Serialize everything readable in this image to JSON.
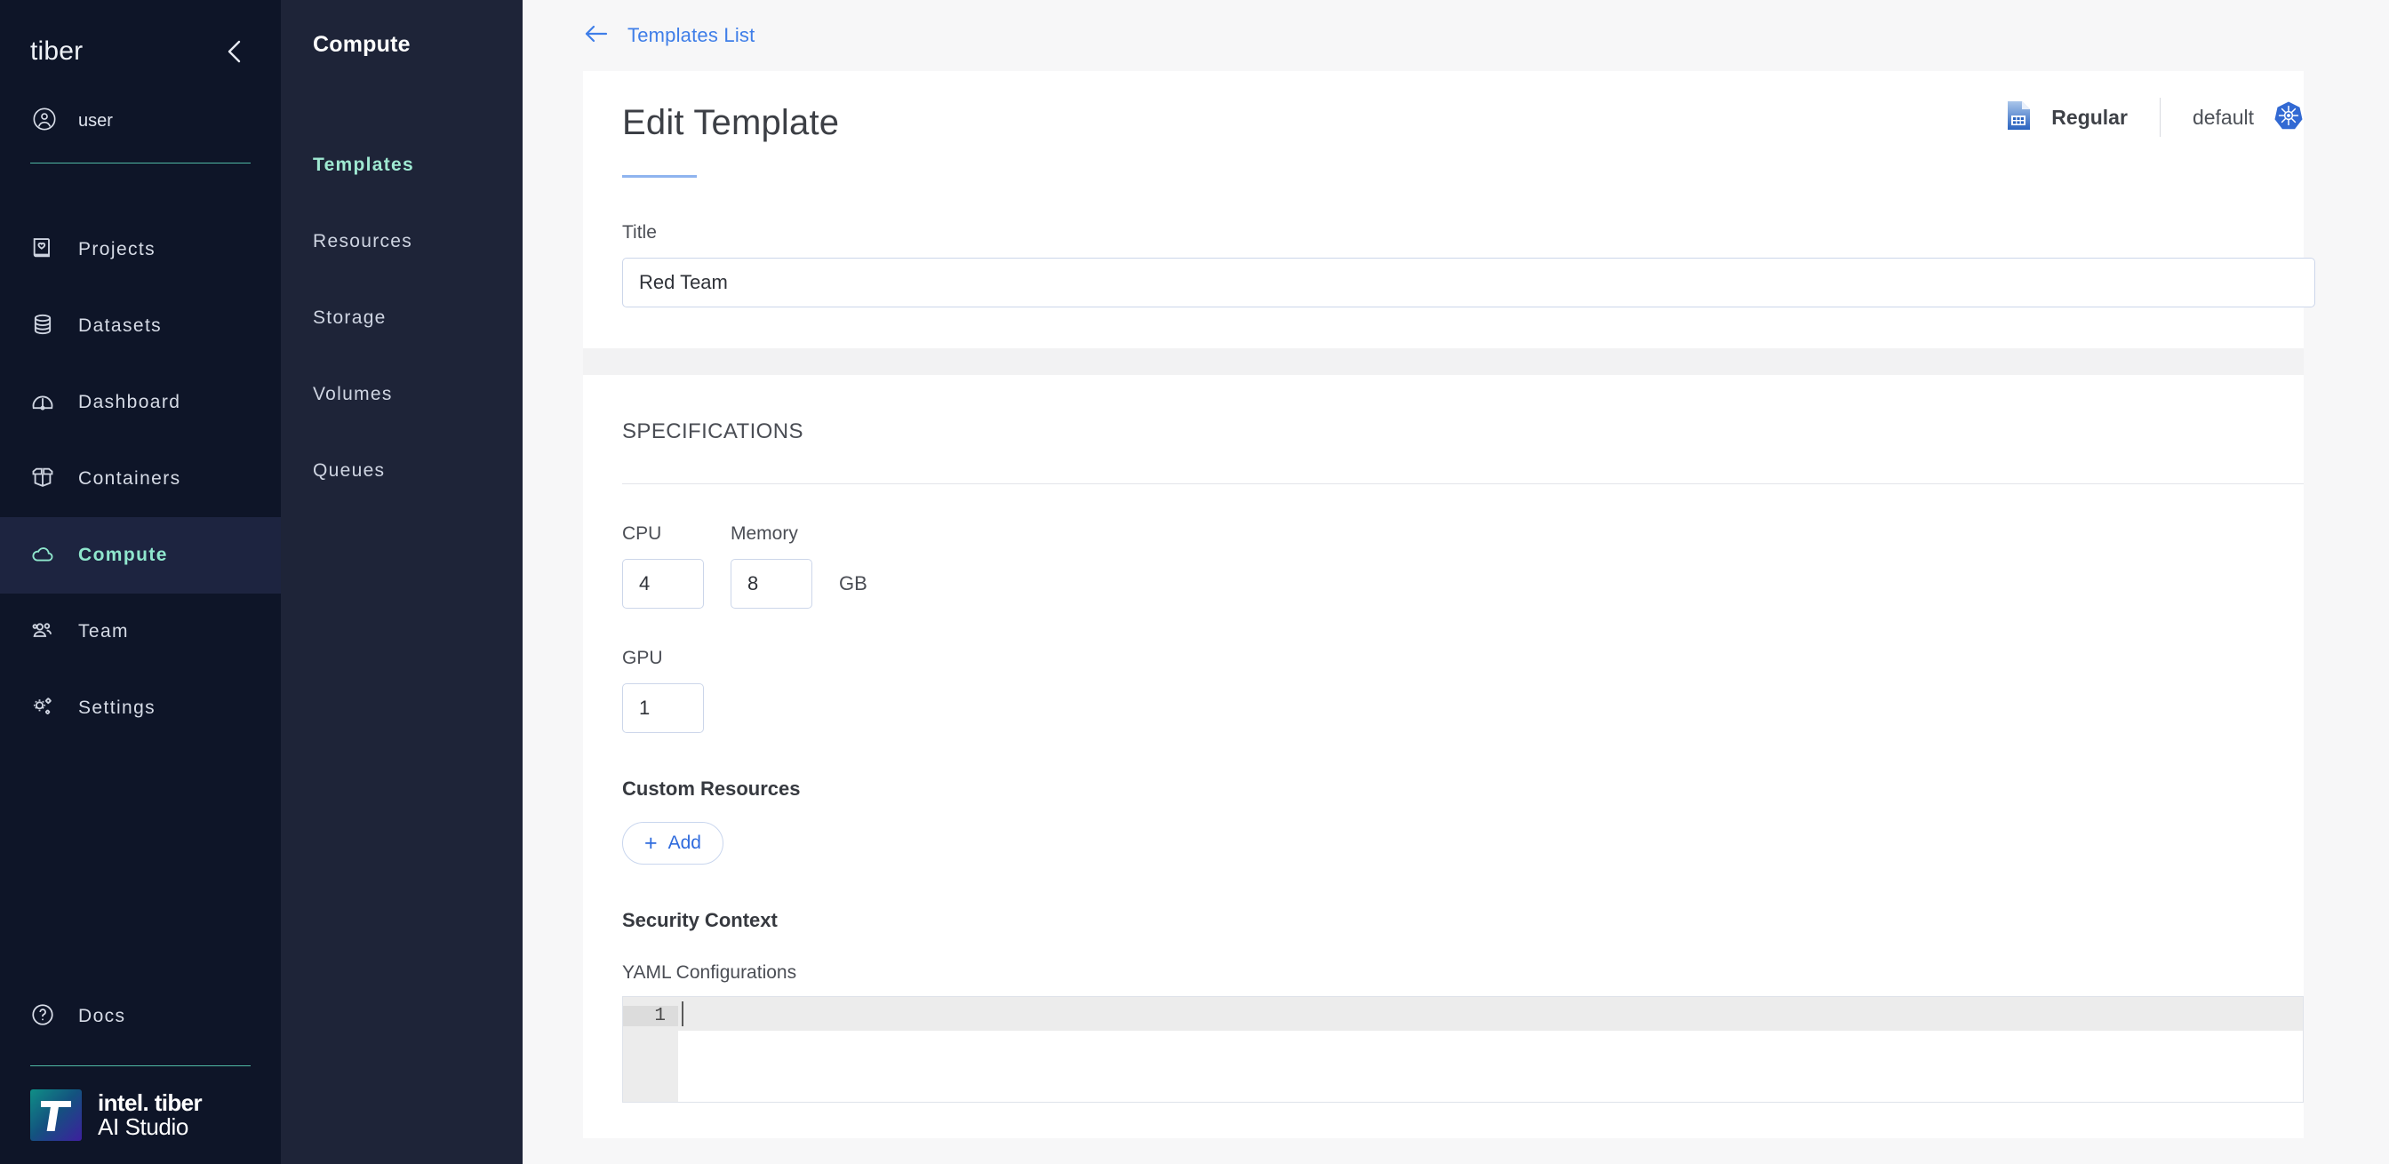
{
  "sidebar": {
    "brand": "tiber",
    "collapse_icon": "chevron-left-icon",
    "user": {
      "icon": "user-circle-icon",
      "name": "user"
    },
    "items": [
      {
        "label": "Projects",
        "icon": "book-heart-icon",
        "active": false
      },
      {
        "label": "Datasets",
        "icon": "database-icon",
        "active": false
      },
      {
        "label": "Dashboard",
        "icon": "gauge-icon",
        "active": false
      },
      {
        "label": "Containers",
        "icon": "box-open-icon",
        "active": false
      },
      {
        "label": "Compute",
        "icon": "cloud-icon",
        "active": true
      },
      {
        "label": "Team",
        "icon": "people-icon",
        "active": false
      },
      {
        "label": "Settings",
        "icon": "gears-icon",
        "active": false
      }
    ],
    "docs": {
      "label": "Docs",
      "icon": "question-circle-icon"
    },
    "logo": {
      "line1": "intel. tiber",
      "line1_sup": "™",
      "line2": "AI Studio"
    },
    "accent_rule_color": "#4fb8a4",
    "active_color": "#8fe7cd",
    "background": "#0e1528"
  },
  "subnav": {
    "title": "Compute",
    "background": "#1e2438",
    "items": [
      {
        "label": "Templates",
        "active": true
      },
      {
        "label": "Resources",
        "active": false
      },
      {
        "label": "Storage",
        "active": false
      },
      {
        "label": "Volumes",
        "active": false
      },
      {
        "label": "Queues",
        "active": false
      }
    ]
  },
  "breadcrumb": {
    "back_icon": "arrow-left-icon",
    "label": "Templates List",
    "color": "#3f7ee8"
  },
  "header": {
    "type_icon": "document-grid-icon",
    "type_label": "Regular",
    "cluster_label": "default",
    "cluster_icon": "kubernetes-icon",
    "kubernetes_color": "#3269D3"
  },
  "page": {
    "title": "Edit Template",
    "title_field": {
      "label": "Title",
      "value": "Red Team",
      "placeholder": ""
    }
  },
  "specifications": {
    "section_title": "SPECIFICATIONS",
    "cpu": {
      "label": "CPU",
      "value": "4"
    },
    "memory": {
      "label": "Memory",
      "value": "8",
      "unit": "GB"
    },
    "gpu": {
      "label": "GPU",
      "value": "1"
    },
    "custom_resources": {
      "heading": "Custom Resources",
      "add_label": "Add",
      "add_icon": "plus-icon"
    },
    "security_context": {
      "heading": "Security Context",
      "yaml_label": "YAML Configurations",
      "line_number": "1",
      "code": ""
    }
  }
}
